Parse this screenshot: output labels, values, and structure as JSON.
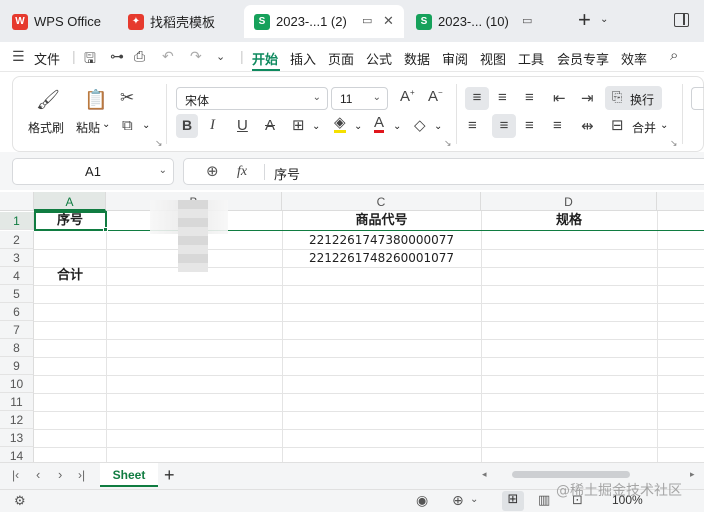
{
  "titlebar": {
    "tabs": [
      {
        "label": "WPS Office",
        "icon": "wps-logo-icon",
        "color": "#e63a2e"
      },
      {
        "label": "找稻壳模板",
        "icon": "docer-icon",
        "color": "#e63a2e"
      },
      {
        "label": "2023-...1 (2)",
        "icon": "sheet-icon",
        "color": "#16a15b"
      },
      {
        "label": "2023-... (10)",
        "icon": "sheet-icon",
        "color": "#16a15b"
      }
    ],
    "sheet_icon_letter": "S"
  },
  "menubar": {
    "file": "文件",
    "tabs": [
      "开始",
      "插入",
      "页面",
      "公式",
      "数据",
      "审阅",
      "视图",
      "工具",
      "会员专享",
      "效率"
    ]
  },
  "ribbon": {
    "format_painter": "格式刷",
    "paste": "粘贴",
    "font_name": "宋体",
    "font_size": "11",
    "bold": "B",
    "italic": "I",
    "underline": "U",
    "strikethrough": "A",
    "wrap_text": "换行",
    "merge": "合并"
  },
  "formula_bar": {
    "cell_ref": "A1",
    "fx": "fx",
    "content": "序号"
  },
  "grid": {
    "columns": [
      "A",
      "B",
      "C",
      "D"
    ],
    "rows": [
      "1",
      "2",
      "3",
      "4",
      "5",
      "6",
      "7",
      "8",
      "9",
      "10",
      "11",
      "12",
      "13",
      "14"
    ],
    "cells": {
      "A1": "序号",
      "C1": "商品代号",
      "D1": "规格",
      "C2": "2212261747380000077",
      "C3": "2212261748260001077",
      "A4": "合计"
    }
  },
  "sheetbar": {
    "sheet_name": "Sheet",
    "add": "+"
  },
  "statusbar": {
    "zoom": "100%",
    "watermark": "@稀土掘金技术社区"
  },
  "colors": {
    "accent": "#0f8a5f",
    "selection": "#107c41"
  }
}
